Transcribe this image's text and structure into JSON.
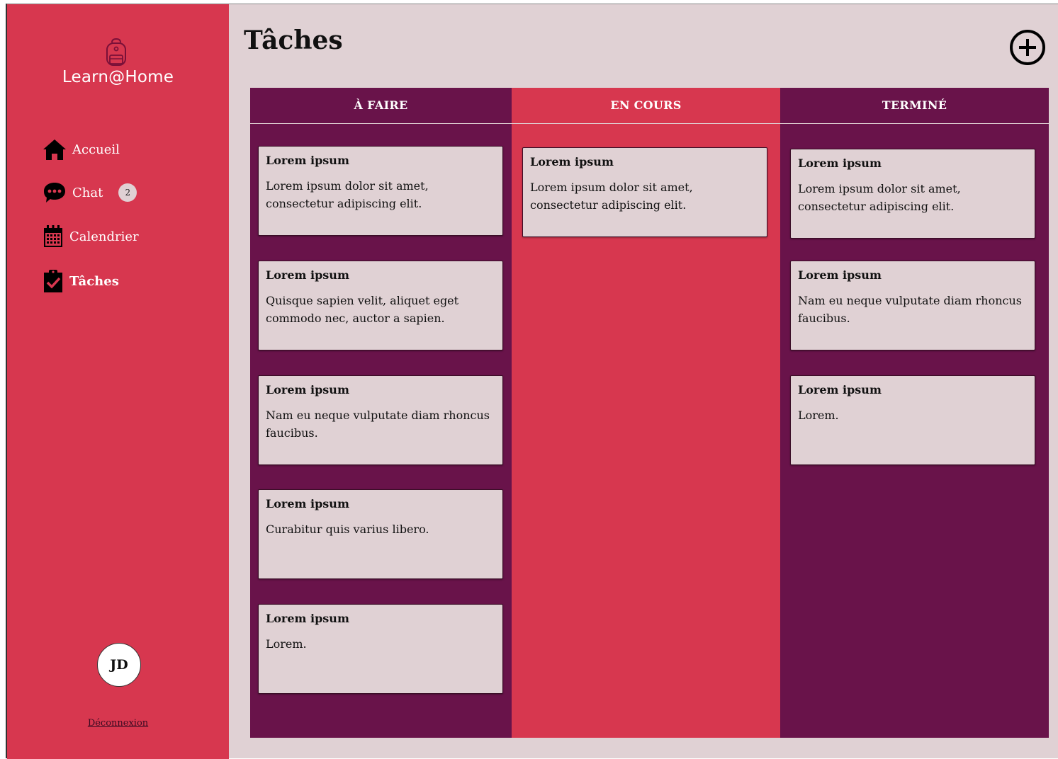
{
  "sidebar": {
    "brand": "Learn@Home",
    "nav": [
      {
        "label": "Accueil",
        "icon": "home-icon"
      },
      {
        "label": "Chat",
        "icon": "chat-icon",
        "badge": "2"
      },
      {
        "label": "Calendrier",
        "icon": "calendar-icon"
      },
      {
        "label": "Tâches",
        "icon": "tasks-icon",
        "active": true
      }
    ],
    "user_initials": "JD",
    "logout_label": "Déconnexion"
  },
  "header": {
    "title": "Tâches",
    "add_icon": "plus-circle-icon"
  },
  "board": {
    "columns": [
      {
        "title": "À FAIRE",
        "cards": [
          {
            "title": "Lorem ipsum",
            "desc": "Lorem ipsum dolor sit amet, consectetur adipiscing elit."
          },
          {
            "title": "Lorem ipsum",
            "desc": "Quisque sapien velit, aliquet eget commodo nec, auctor a sapien."
          },
          {
            "title": "Lorem ipsum",
            "desc": "Nam eu neque vulputate diam rhoncus faucibus."
          },
          {
            "title": "Lorem ipsum",
            "desc": "Curabitur quis varius libero."
          },
          {
            "title": "Lorem ipsum",
            "desc": "Lorem."
          }
        ]
      },
      {
        "title": "EN COURS",
        "cards": [
          {
            "title": "Lorem ipsum",
            "desc": "Lorem ipsum dolor sit amet, consectetur adipiscing elit."
          }
        ]
      },
      {
        "title": "TERMINÉ",
        "cards": [
          {
            "title": "Lorem ipsum",
            "desc": "Lorem ipsum dolor sit amet, consectetur adipiscing elit."
          },
          {
            "title": "Lorem ipsum",
            "desc": "Nam eu neque vulputate diam rhoncus faucibus."
          },
          {
            "title": "Lorem ipsum",
            "desc": "Lorem."
          }
        ]
      }
    ]
  },
  "colors": {
    "sidebar": "#d7374f",
    "background": "#e0d1d4",
    "column_dark": "#69134a",
    "column_accent": "#d7374f"
  }
}
